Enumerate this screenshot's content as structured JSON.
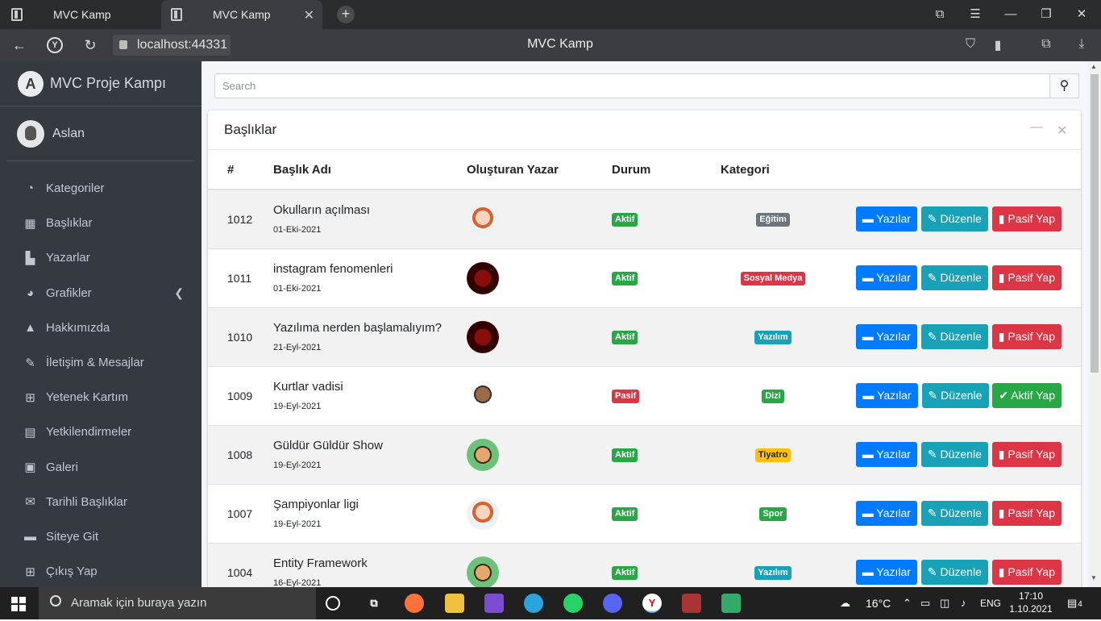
{
  "browser": {
    "tabs": [
      {
        "label": "MVC Kamp"
      },
      {
        "label": "MVC Kamp"
      }
    ],
    "url": "localhost:44331",
    "page_title": "MVC Kamp"
  },
  "sidebar": {
    "brand": "MVC Proje Kampı",
    "user": "Aslan",
    "items": [
      {
        "label": "Kategoriler",
        "icon": "dashboard-icon"
      },
      {
        "label": "Başlıklar",
        "icon": "grid-icon"
      },
      {
        "label": "Yazarlar",
        "icon": "book-reader-icon"
      },
      {
        "label": "Grafikler",
        "icon": "chart-pie-icon"
      },
      {
        "label": "Hakkımızda",
        "icon": "tree-icon"
      },
      {
        "label": "İletişim & Mesajlar",
        "icon": "edit-icon"
      },
      {
        "label": "Yetenek Kartım",
        "icon": "table-icon"
      },
      {
        "label": "Yetkilendirmeler",
        "icon": "calendar-icon"
      },
      {
        "label": "Galeri",
        "icon": "image-icon"
      },
      {
        "label": "Tarihli Başlıklar",
        "icon": "envelope-icon"
      },
      {
        "label": "Siteye Git",
        "icon": "book-icon"
      },
      {
        "label": "Çıkış Yap",
        "icon": "plus-square-icon"
      }
    ]
  },
  "search": {
    "placeholder": "Search"
  },
  "card": {
    "title": "Başlıklar",
    "columns": [
      "#",
      "Başlık Adı",
      "Oluşturan Yazar",
      "Durum",
      "Kategori"
    ],
    "rows": [
      {
        "id": "1012",
        "title": "Okulların açılması",
        "date": "01-Eki-2021",
        "status": "Aktif",
        "status_color": "#28a745",
        "category": "Eğitim",
        "category_color": "#6c757d",
        "toggle": "Pasif Yap",
        "toggle_color": "#dc3545",
        "avatar": "avatar-red-hair"
      },
      {
        "id": "1011",
        "title": "instagram fenomenleri",
        "date": "01-Eki-2021",
        "status": "Aktif",
        "status_color": "#28a745",
        "category": "Sosyal Medya",
        "category_color": "#dc3545",
        "toggle": "Pasif Yap",
        "toggle_color": "#dc3545",
        "avatar": "avatar-lion"
      },
      {
        "id": "1010",
        "title": "Yazılıma nerden başlamalıyım?",
        "date": "21-Eyl-2021",
        "status": "Aktif",
        "status_color": "#28a745",
        "category": "Yazılım",
        "category_color": "#17a2b8",
        "toggle": "Pasif Yap",
        "toggle_color": "#dc3545",
        "avatar": "avatar-lion"
      },
      {
        "id": "1009",
        "title": "Kurtlar vadisi",
        "date": "19-Eyl-2021",
        "status": "Pasif",
        "status_color": "#dc3545",
        "category": "Dizi",
        "category_color": "#28a745",
        "toggle": "Aktif Yap",
        "toggle_color": "#28a745",
        "avatar": "avatar-glasses-man"
      },
      {
        "id": "1008",
        "title": "Güldür Güldür Show",
        "date": "19-Eyl-2021",
        "status": "Aktif",
        "status_color": "#28a745",
        "category": "Tiyatro",
        "category_color": "#ffc107",
        "toggle": "Pasif Yap",
        "toggle_color": "#dc3545",
        "avatar": "avatar-green-glasses"
      },
      {
        "id": "1007",
        "title": "Şampiyonlar ligi",
        "date": "19-Eyl-2021",
        "status": "Aktif",
        "status_color": "#28a745",
        "category": "Spor",
        "category_color": "#28a745",
        "toggle": "Pasif Yap",
        "toggle_color": "#dc3545",
        "avatar": "avatar-red-hair"
      },
      {
        "id": "1004",
        "title": "Entity Framework",
        "date": "16-Eyl-2021",
        "status": "Aktif",
        "status_color": "#28a745",
        "category": "Yazılım",
        "category_color": "#17a2b8",
        "toggle": "Pasif Yap",
        "toggle_color": "#dc3545",
        "avatar": "avatar-green-glasses"
      }
    ],
    "actions": {
      "posts": "Yazılar",
      "edit": "Düzenle"
    }
  },
  "taskbar": {
    "search_placeholder": "Aramak için buraya yazın",
    "weather": "16°C",
    "lang": "ENG",
    "time": "17:10",
    "date": "1.10.2021",
    "notifications": "4"
  }
}
